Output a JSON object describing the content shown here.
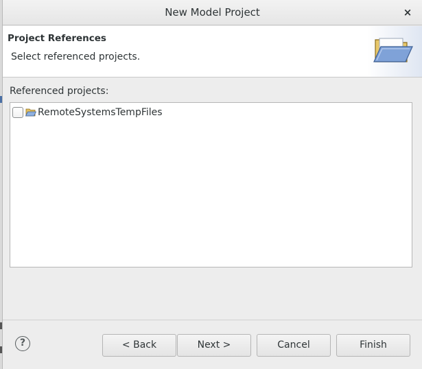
{
  "window": {
    "title": "New Model Project",
    "close_glyph": "×"
  },
  "header": {
    "title": "Project References",
    "description": "Select referenced projects.",
    "banner_icon": "folder-open-icon"
  },
  "references": {
    "label": "Referenced projects:",
    "items": [
      {
        "label": "RemoteSystemsTempFiles",
        "checked": false,
        "icon": "folder-icon"
      }
    ]
  },
  "footer": {
    "help_glyph": "?",
    "back_label": "< Back",
    "next_label": "Next >",
    "cancel_label": "Cancel",
    "finish_label": "Finish"
  }
}
